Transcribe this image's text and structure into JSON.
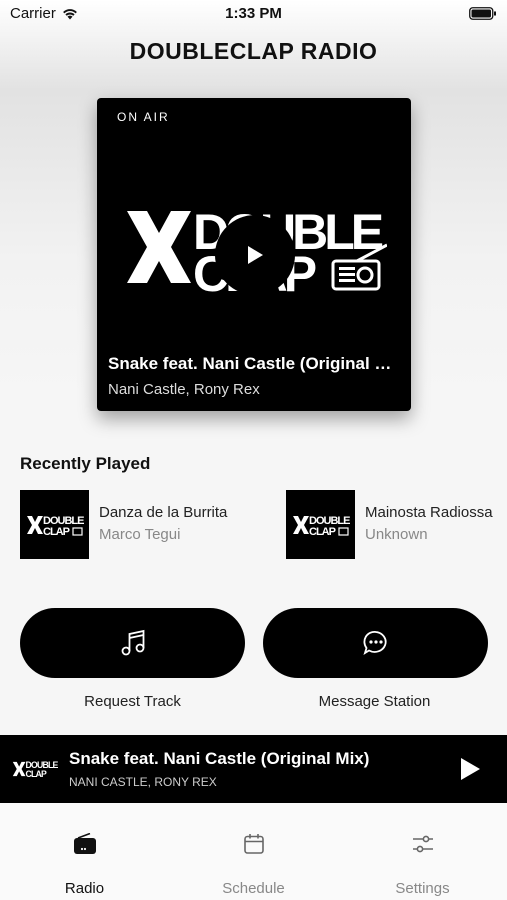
{
  "status_bar": {
    "carrier": "Carrier",
    "time": "1:33 PM"
  },
  "header": {
    "title": "DOUBLECLAP RADIO"
  },
  "now_playing_card": {
    "badge": "ON AIR",
    "logo_text_top": "DOUBLE",
    "logo_text_bottom": "CLAP",
    "title": "Snake feat. Nani Castle (Original Mix)",
    "artist": "Nani Castle, Rony Rex"
  },
  "recently_played": {
    "heading": "Recently Played",
    "items": [
      {
        "title": "Danza de la Burrita",
        "artist": "Marco Tegui"
      },
      {
        "title": "Mainosta Radiossa",
        "artist": "Unknown"
      }
    ]
  },
  "actions": [
    {
      "label": "Request Track",
      "icon": "music-note-icon"
    },
    {
      "label": "Message Station",
      "icon": "chat-bubble-icon"
    }
  ],
  "mini_player": {
    "title": "Snake feat. Nani Castle (Original Mix)",
    "artist": "NANI CASTLE, RONY REX"
  },
  "tabs": [
    {
      "label": "Radio",
      "icon": "radio-icon",
      "active": true
    },
    {
      "label": "Schedule",
      "icon": "calendar-icon",
      "active": false
    },
    {
      "label": "Settings",
      "icon": "sliders-icon",
      "active": false
    }
  ]
}
